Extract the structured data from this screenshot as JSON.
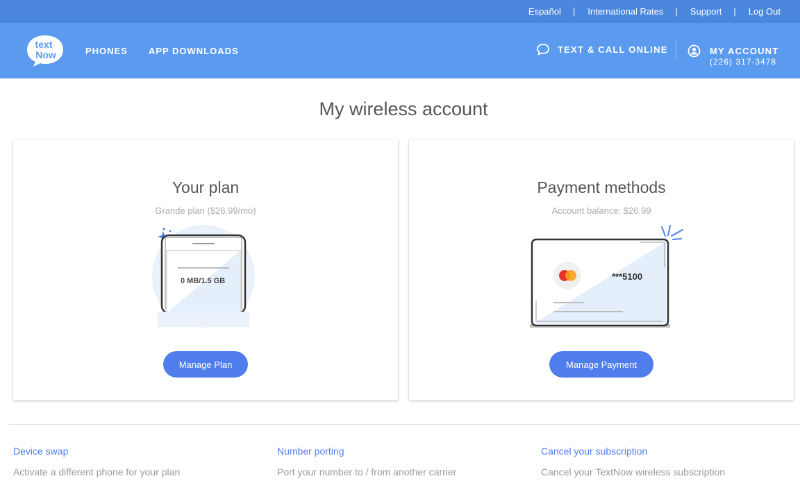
{
  "utility_bar": {
    "links": [
      "Español",
      "International Rates",
      "Support",
      "Log Out"
    ],
    "separator": "|"
  },
  "header": {
    "logo_text": "TextNow",
    "nav": [
      "PHONES",
      "APP DOWNLOADS"
    ],
    "text_call_label": "TEXT & CALL ONLINE",
    "account_label": "MY ACCOUNT",
    "account_number": "(226) 317-3478",
    "colors": {
      "utility_bar": "#4a86dd",
      "header": "#5b9bef"
    }
  },
  "page": {
    "title": "My wireless account"
  },
  "plan_card": {
    "title": "Your plan",
    "subtitle": "Grande plan ($26.99/mo)",
    "usage": "0 MB/1.5 GB",
    "button_label": "Manage Plan"
  },
  "payment_card": {
    "title": "Payment methods",
    "subtitle": "Account balance: $26.99",
    "card_number": "***5100",
    "card_brand": "MasterCard",
    "button_label": "Manage Payment"
  },
  "bottom_links": [
    {
      "title": "Device swap",
      "description": "Activate a different phone for your plan"
    },
    {
      "title": "Number porting",
      "description": "Port your number to / from another carrier"
    },
    {
      "title": "Cancel your subscription",
      "description": "Cancel your TextNow wireless subscription"
    }
  ],
  "accent_color": "#4f7dec"
}
